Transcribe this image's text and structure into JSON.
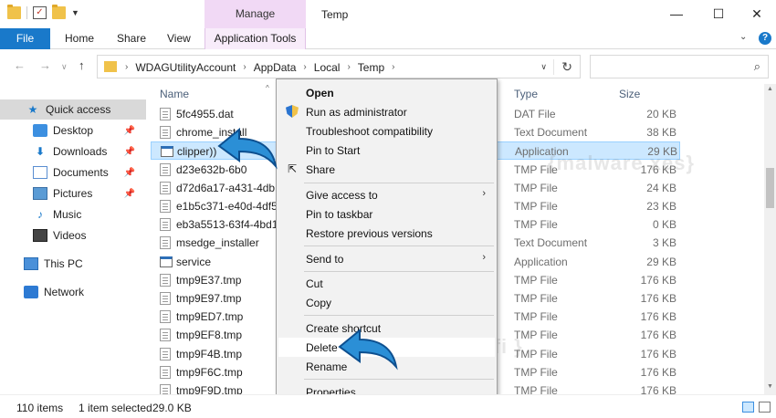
{
  "window": {
    "title": "Temp",
    "manage_label": "Manage",
    "minimize": "—",
    "maximize": "☐",
    "close": "✕"
  },
  "ribbon": {
    "file": "File",
    "home": "Home",
    "share": "Share",
    "view": "View",
    "app_tools": "Application Tools",
    "help": "?"
  },
  "address": {
    "crumbs": [
      "WDAGUtilityAccount",
      "AppData",
      "Local",
      "Temp"
    ],
    "search_placeholder": ""
  },
  "nav_pane": {
    "items": [
      {
        "label": "Quick access",
        "icon": "star-icon"
      },
      {
        "label": "Desktop",
        "icon": "desktop-icon"
      },
      {
        "label": "Downloads",
        "icon": "downloads-icon"
      },
      {
        "label": "Documents",
        "icon": "documents-icon"
      },
      {
        "label": "Pictures",
        "icon": "pictures-icon"
      },
      {
        "label": "Music",
        "icon": "music-icon"
      },
      {
        "label": "Videos",
        "icon": "videos-icon"
      },
      {
        "label": "This PC",
        "icon": "computer-icon"
      },
      {
        "label": "Network",
        "icon": "network-icon"
      }
    ]
  },
  "columns": {
    "name": "Name",
    "type": "Type",
    "size": "Size"
  },
  "files": [
    {
      "name": "5fc4955.dat",
      "type": "DAT File",
      "size": "20 KB",
      "icon": "doc"
    },
    {
      "name": "chrome_install",
      "type": "Text Document",
      "size": "38 KB",
      "icon": "doc"
    },
    {
      "name": "clipper))",
      "type": "Application",
      "size": "29 KB",
      "icon": "app"
    },
    {
      "name": "d23e632b-6b0",
      "type": "TMP File",
      "size": "176 KB",
      "icon": "doc"
    },
    {
      "name": "d72d6a17-a431-4db",
      "type": "TMP File",
      "size": "24 KB",
      "icon": "doc"
    },
    {
      "name": "e1b5c371-e40d-4df5",
      "type": "TMP File",
      "size": "23 KB",
      "icon": "doc"
    },
    {
      "name": "eb3a5513-63f4-4bd1",
      "type": "TMP File",
      "size": "0 KB",
      "icon": "doc"
    },
    {
      "name": "msedge_installer",
      "type": "Text Document",
      "size": "3 KB",
      "icon": "doc"
    },
    {
      "name": "service",
      "type": "Application",
      "size": "29 KB",
      "icon": "app"
    },
    {
      "name": "tmp9E37.tmp",
      "type": "TMP File",
      "size": "176 KB",
      "icon": "doc"
    },
    {
      "name": "tmp9E97.tmp",
      "type": "TMP File",
      "size": "176 KB",
      "icon": "doc"
    },
    {
      "name": "tmp9ED7.tmp",
      "type": "TMP File",
      "size": "176 KB",
      "icon": "doc"
    },
    {
      "name": "tmp9EF8.tmp",
      "type": "TMP File",
      "size": "176 KB",
      "icon": "doc"
    },
    {
      "name": "tmp9F4B.tmp",
      "type": "TMP File",
      "size": "176 KB",
      "icon": "doc"
    },
    {
      "name": "tmp9F6C.tmp",
      "type": "TMP File",
      "size": "176 KB",
      "icon": "doc"
    },
    {
      "name": "tmp9F9D.tmp",
      "type": "TMP File",
      "size": "176 KB",
      "icon": "doc"
    }
  ],
  "context_menu": {
    "items": [
      {
        "label": "Open",
        "bold": true
      },
      {
        "label": "Run as administrator",
        "icon": "shield-icon"
      },
      {
        "label": "Troubleshoot compatibility"
      },
      {
        "label": "Pin to Start"
      },
      {
        "label": "Share",
        "icon": "share-icon"
      },
      {
        "label": "Give access to",
        "submenu": true
      },
      {
        "label": "Pin to taskbar"
      },
      {
        "label": "Restore previous versions"
      },
      {
        "label": "Send to",
        "submenu": true
      },
      {
        "label": "Cut"
      },
      {
        "label": "Copy"
      },
      {
        "label": "Create shortcut"
      },
      {
        "label": "Delete",
        "hover": true
      },
      {
        "label": "Rename"
      },
      {
        "label": "Properties"
      }
    ]
  },
  "status": {
    "count": "110 items",
    "selected": "1 item selected",
    "size": "29.0 KB"
  },
  "watermark": {
    "top": "{malware xes}",
    "bottom": "{malwarefi }"
  },
  "colors": {
    "accent": "#1979ca",
    "selection": "#cce8ff",
    "manage_tab": "#f1d9f5",
    "arrow": "#2b8fd6"
  }
}
